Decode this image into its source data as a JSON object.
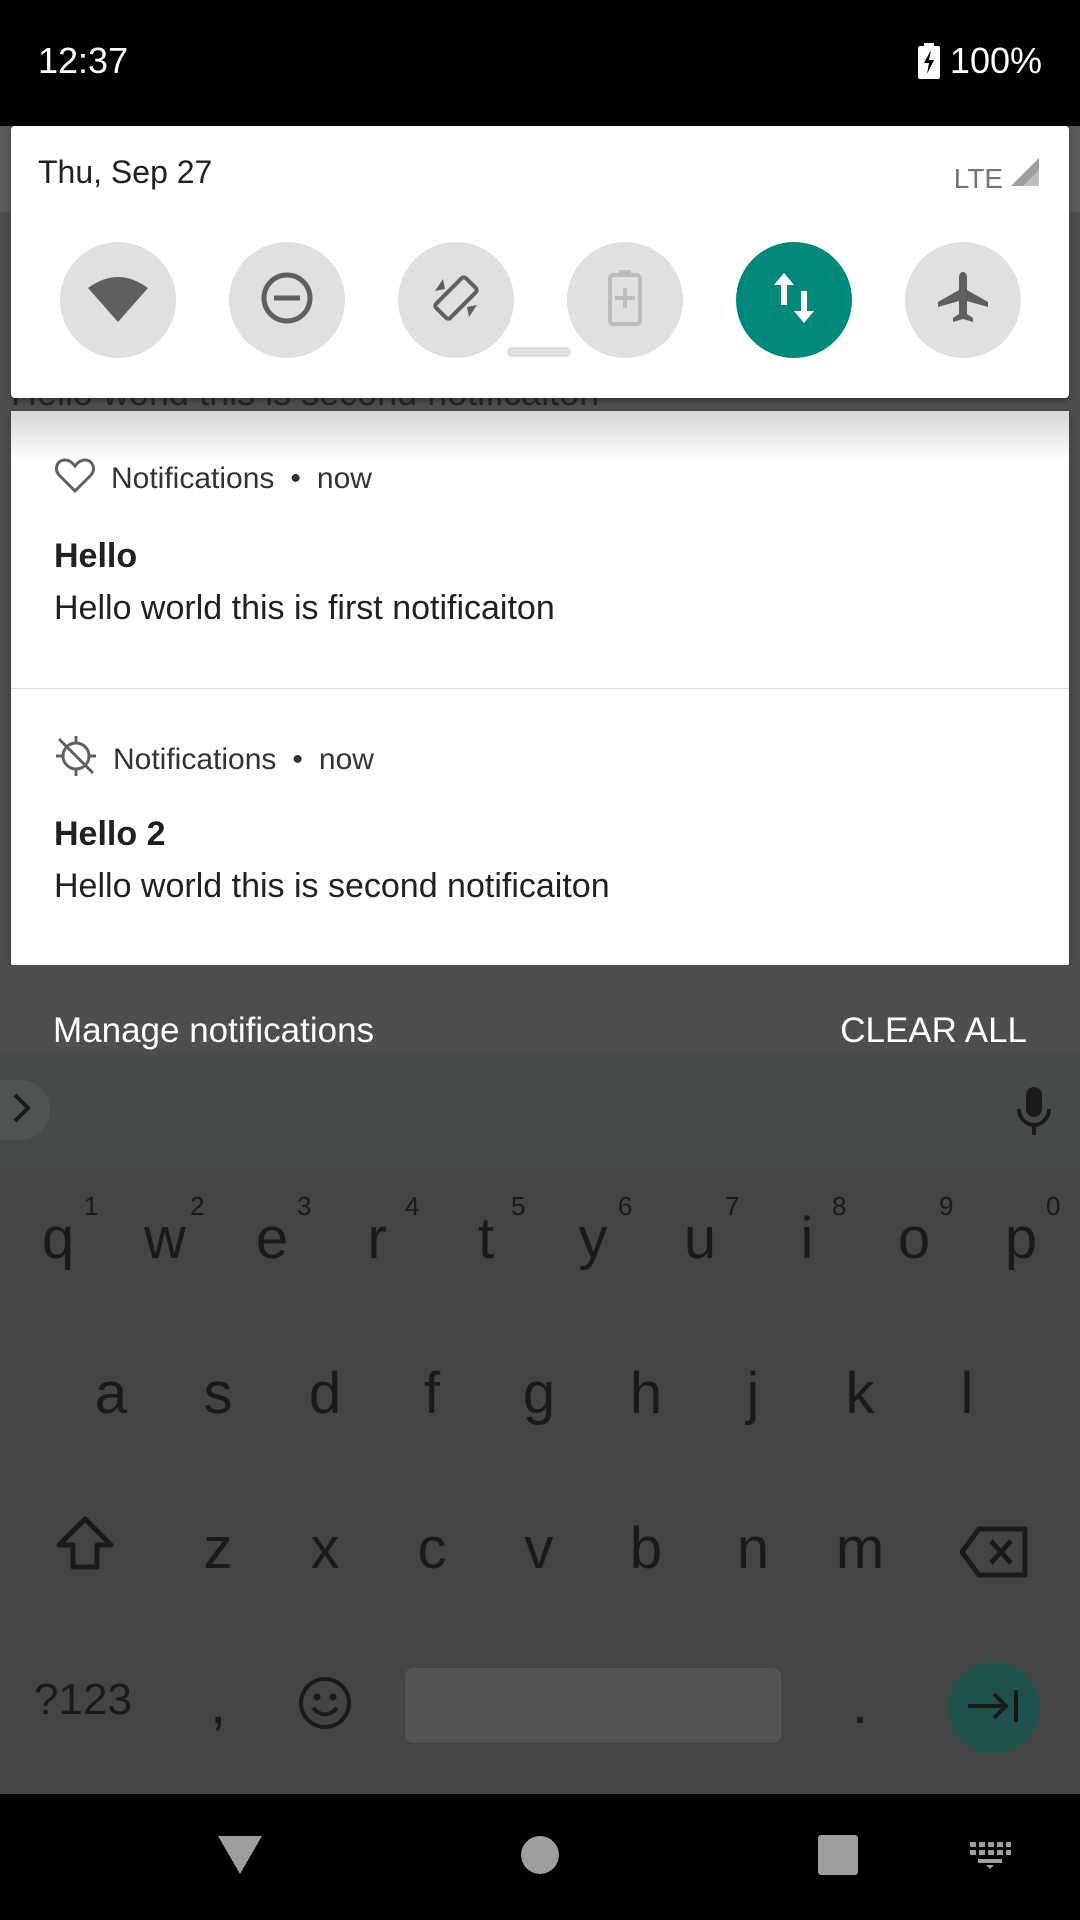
{
  "status_bar": {
    "time": "12:37",
    "battery": "100%",
    "icons": [
      "battery-charging-icon"
    ]
  },
  "quick_settings": {
    "date": "Thu, Sep 27",
    "network": "LTE",
    "tiles": [
      {
        "name": "wifi",
        "icon": "wifi-icon",
        "active": false
      },
      {
        "name": "do-not-disturb",
        "icon": "do-not-disturb-icon",
        "active": false
      },
      {
        "name": "auto-rotate",
        "icon": "auto-rotate-icon",
        "active": false
      },
      {
        "name": "battery-saver",
        "icon": "battery-saver-icon",
        "active": false
      },
      {
        "name": "mobile-data",
        "icon": "mobile-data-icon",
        "active": true
      },
      {
        "name": "airplane-mode",
        "icon": "airplane-icon",
        "active": false
      }
    ],
    "accent": "#00897b"
  },
  "peek_text": "Hello world this is second notificaiton",
  "notifications": [
    {
      "icon": "heart-icon",
      "app": "Notifications",
      "separator": "•",
      "time": "now",
      "title": "Hello",
      "body": "Hello world this is first notificaiton"
    },
    {
      "icon": "gps-off-icon",
      "app": "Notifications",
      "separator": "•",
      "time": "now",
      "title": "Hello 2",
      "body": "Hello world this is second notificaiton"
    }
  ],
  "footer": {
    "manage": "Manage notifications",
    "clear_all": "CLEAR ALL"
  },
  "keyboard": {
    "row1": [
      "q",
      "w",
      "e",
      "r",
      "t",
      "y",
      "u",
      "i",
      "o",
      "p"
    ],
    "row1_hints": [
      "1",
      "2",
      "3",
      "4",
      "5",
      "6",
      "7",
      "8",
      "9",
      "0"
    ],
    "row2": [
      "a",
      "s",
      "d",
      "f",
      "g",
      "h",
      "j",
      "k",
      "l"
    ],
    "row3": [
      "z",
      "x",
      "c",
      "v",
      "b",
      "n",
      "m"
    ],
    "symbols": "?123",
    "comma": ",",
    "period": "."
  },
  "nav": [
    "back-icon",
    "home-icon",
    "recents-icon",
    "keyboard-switch-icon"
  ]
}
